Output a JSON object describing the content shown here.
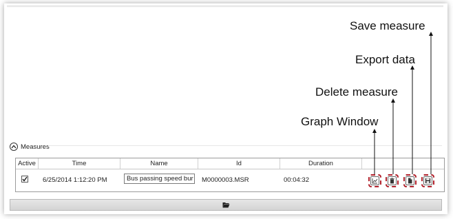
{
  "annotations": {
    "save": "Save measure",
    "export": "Export data",
    "delete": "Delete measure",
    "graph": "Graph Window"
  },
  "measures": {
    "title": "Measures",
    "toggle_icon": "chevron-up-circle-icon",
    "columns": [
      "Active",
      "Time",
      "Name",
      "Id",
      "Duration"
    ],
    "rows": [
      {
        "active": true,
        "time": "6/25/2014 1:12:20 PM",
        "name": "Bus passing speed bur",
        "id": "M0000003.MSR",
        "duration": "00:04:32"
      }
    ],
    "actions": [
      {
        "name": "graph-window",
        "icon": "line-chart-icon"
      },
      {
        "name": "delete-measure",
        "icon": "trash-icon"
      },
      {
        "name": "export-data",
        "icon": "document-export-icon"
      },
      {
        "name": "save-measure",
        "icon": "floppy-disk-icon"
      }
    ]
  },
  "footer": {
    "icon": "folder-open-icon"
  },
  "colors": {
    "highlight_border": "#b0202a",
    "arrow": "#111111"
  }
}
